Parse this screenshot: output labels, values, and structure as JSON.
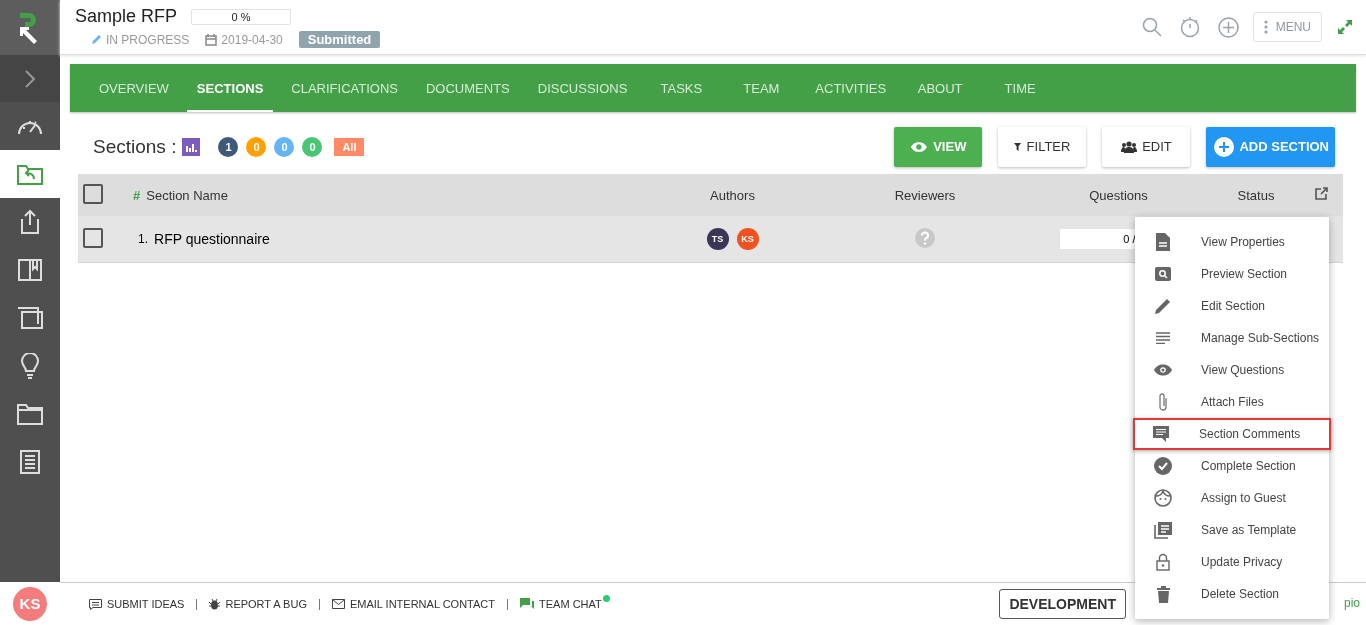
{
  "sidebar": {
    "items": [
      {
        "selected": false
      },
      {
        "selected": true
      },
      {
        "selected": false
      },
      {
        "selected": false
      },
      {
        "selected": false
      },
      {
        "selected": false
      },
      {
        "selected": false
      },
      {
        "selected": false
      }
    ]
  },
  "user_avatar": {
    "initials": "KS"
  },
  "header": {
    "title": "Sample RFP",
    "progress": {
      "label": "0 %",
      "level": 0
    },
    "status": "IN PROGRESS",
    "due_date": "2019-04-30",
    "badge": "Submitted",
    "menu_button": "MENU"
  },
  "tabs": [
    {
      "label": "OVERVIEW",
      "selected": false
    },
    {
      "label": "SECTIONS",
      "selected": true
    },
    {
      "label": "CLARIFICATIONS",
      "selected": false
    },
    {
      "label": "DOCUMENTS",
      "selected": false
    },
    {
      "label": "DISCUSSIONS",
      "selected": false
    },
    {
      "label": "TASKS",
      "selected": false
    },
    {
      "label": "TEAM",
      "selected": false
    },
    {
      "label": "ACTIVITIES",
      "selected": false
    },
    {
      "label": "ABOUT",
      "selected": false
    },
    {
      "label": "TIME",
      "selected": false
    }
  ],
  "toolbar": {
    "label": "Sections :",
    "counts": [
      {
        "kind": "count",
        "label": "1",
        "color": "#3e5a7a"
      },
      {
        "kind": "count",
        "label": "0",
        "color": "#ffa000"
      },
      {
        "kind": "count",
        "label": "0",
        "color": "#64b5f6"
      },
      {
        "kind": "count",
        "label": "0",
        "color": "#47c774"
      },
      {
        "kind": "all",
        "label": "All",
        "color": "#ff8a65"
      }
    ],
    "buttons": [
      {
        "kind": "view",
        "label": "VIEW"
      },
      {
        "kind": "filter",
        "label": "FILTER"
      },
      {
        "kind": "edit",
        "label": "EDIT"
      },
      {
        "kind": "add",
        "label": "ADD SECTION"
      }
    ]
  },
  "table": {
    "select_all_checked": false,
    "name_marker": "#",
    "columns": [
      "Section Name",
      "Authors",
      "Reviewers",
      "Questions",
      "Status"
    ],
    "rows": [
      {
        "checked": false,
        "number": "1.",
        "name": "RFP questionnaire",
        "authors": [
          {
            "initials": "TS",
            "color": "#3b3556"
          },
          {
            "initials": "KS",
            "color": "#f4511e"
          }
        ],
        "questions": {
          "label": "0 /",
          "level": 0
        }
      }
    ]
  },
  "context_menu": {
    "items": [
      {
        "label": "View Properties",
        "highlighted": false
      },
      {
        "label": "Preview Section",
        "highlighted": false
      },
      {
        "label": "Edit Section",
        "highlighted": false
      },
      {
        "label": "Manage Sub-Sections",
        "highlighted": false
      },
      {
        "label": "View Questions",
        "highlighted": false
      },
      {
        "label": "Attach Files",
        "highlighted": false
      },
      {
        "label": "Section Comments",
        "highlighted": true
      },
      {
        "label": "Complete Section",
        "highlighted": false
      },
      {
        "label": "Assign to Guest",
        "highlighted": false
      },
      {
        "label": "Save as Template",
        "highlighted": false
      },
      {
        "label": "Update Privacy",
        "highlighted": false
      },
      {
        "label": "Delete Section",
        "highlighted": false
      }
    ]
  },
  "footer": {
    "links": [
      {
        "label": "SUBMIT IDEAS",
        "online": false
      },
      {
        "label": "REPORT A BUG",
        "online": false
      },
      {
        "label": "EMAIL INTERNAL CONTACT",
        "online": false
      },
      {
        "label": "TEAM CHAT",
        "online": true
      }
    ],
    "environment": "DEVELOPMENT",
    "trailing_text": "pio"
  }
}
